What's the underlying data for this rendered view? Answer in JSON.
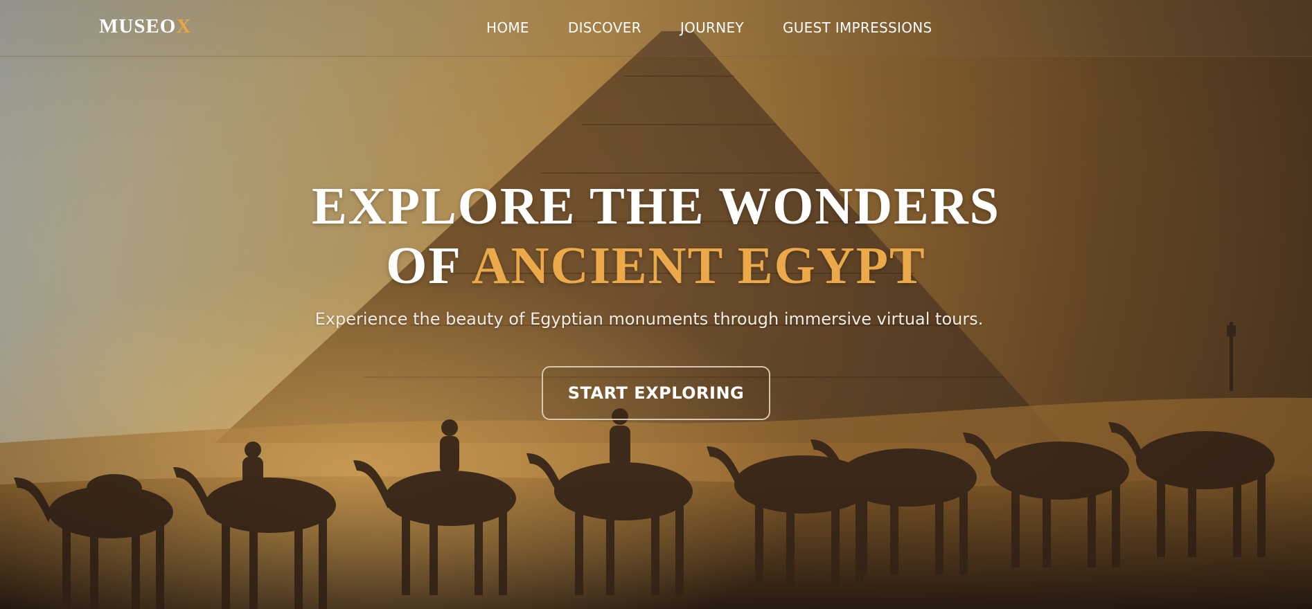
{
  "brand": {
    "name_main": "MUSEO",
    "name_accent": "X"
  },
  "nav": {
    "items": [
      {
        "label": "HOME"
      },
      {
        "label": "DISCOVER"
      },
      {
        "label": "JOURNEY"
      },
      {
        "label": "GUEST IMPRESSIONS"
      }
    ]
  },
  "hero": {
    "title_line1": "EXPLORE THE WONDERS",
    "title_line2_prefix": "OF ",
    "title_line2_highlight": "ANCIENT EGYPT",
    "subtitle": "Experience the beauty of Egyptian monuments through immersive virtual tours.",
    "cta_label": "START EXPLORING"
  },
  "colors": {
    "accent": "#eba94a",
    "text": "#ffffff"
  }
}
